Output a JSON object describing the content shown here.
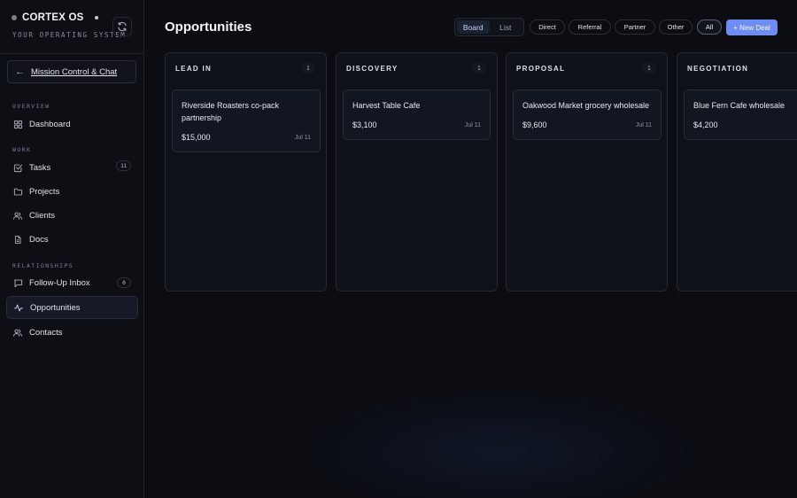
{
  "sidebar": {
    "brand": "CORTEX OS",
    "tagline": "YOUR OPERATING SYSTEM",
    "mission_button": "Mission Control & Chat",
    "sections": {
      "overview": "OVERVIEW",
      "work": "WORK",
      "relationships": "RELATIONSHIPS"
    },
    "items": {
      "dashboard": "Dashboard",
      "tasks": "Tasks",
      "tasks_badge": "11",
      "projects": "Projects",
      "clients": "Clients",
      "docs": "Docs",
      "followup": "Follow-Up Inbox",
      "followup_badge": "6",
      "opportunities": "Opportunities",
      "contacts": "Contacts"
    }
  },
  "header": {
    "title": "Opportunities",
    "view_board": "Board",
    "view_list": "List",
    "filters": [
      "Direct",
      "Referral",
      "Partner",
      "Other",
      "All"
    ],
    "active_filter": "All",
    "new_deal": "+ New Deal"
  },
  "columns": [
    {
      "title": "LEAD IN",
      "count": "1",
      "cards": [
        {
          "title": "Riverside Roasters co-pack partnership",
          "amount": "$15,000",
          "date": "Jul 11"
        }
      ]
    },
    {
      "title": "DISCOVERY",
      "count": "1",
      "cards": [
        {
          "title": "Harvest Table Cafe",
          "amount": "$3,100",
          "date": "Jul 11"
        }
      ]
    },
    {
      "title": "PROPOSAL",
      "count": "1",
      "cards": [
        {
          "title": "Oakwood Market grocery wholesale",
          "amount": "$9,600",
          "date": "Jul 11"
        }
      ]
    },
    {
      "title": "NEGOTIATION",
      "count": "",
      "cards": [
        {
          "title": "Blue Fern Cafe wholesale",
          "amount": "$4,200",
          "date": ""
        }
      ]
    }
  ],
  "colors": {
    "accent": "#6f8df0",
    "background": "#0b0d13",
    "active_nav": "#151a26"
  }
}
